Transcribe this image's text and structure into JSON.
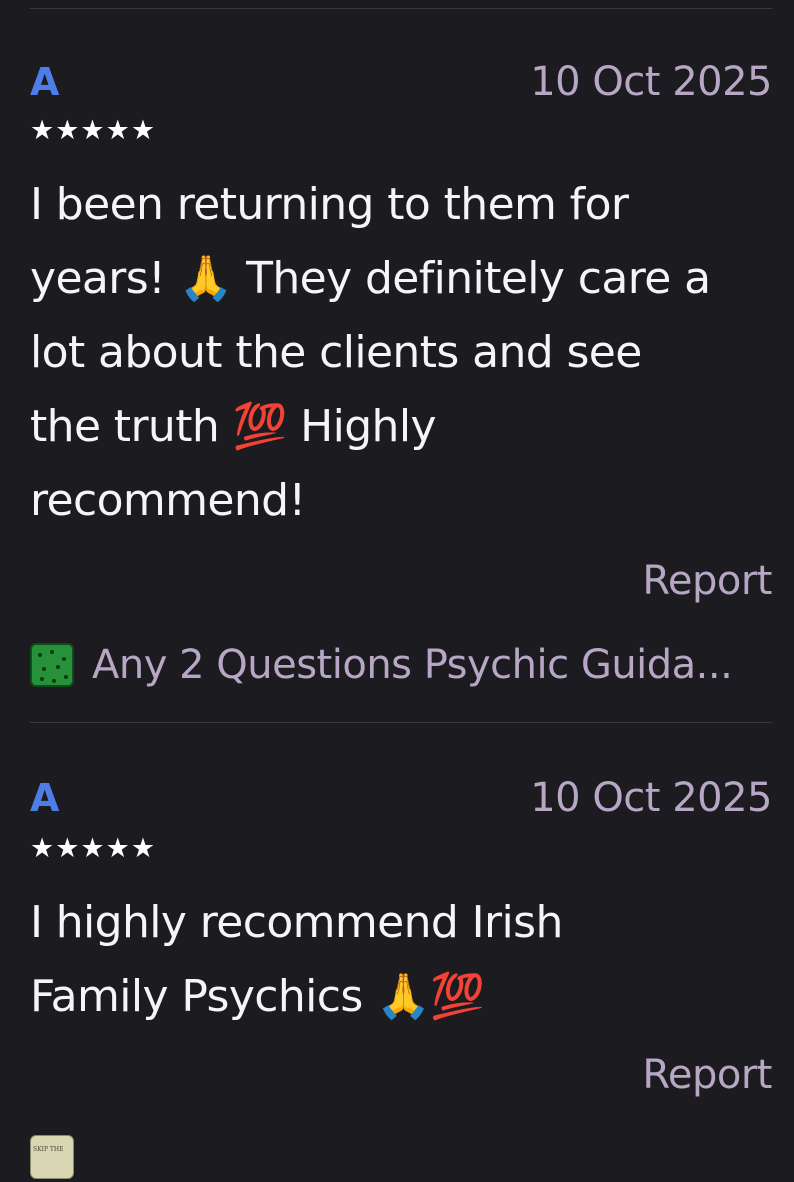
{
  "reviews": [
    {
      "reviewer": "A",
      "date": "10 Oct 2025",
      "rating": 5,
      "stars": "★★★★★",
      "text_lines": [
        "I been returning to them for",
        "years! 🙏 They definitely care a",
        "lot about the clients and see",
        "the truth 💯 Highly",
        "recommend!"
      ],
      "report_label": "Report",
      "product": {
        "title": "Any 2 Questions Psychic Guida...",
        "thumbnail_icon": "green-product-thumbnail"
      }
    },
    {
      "reviewer": "A",
      "date": "10 Oct 2025",
      "rating": 5,
      "stars": "★★★★★",
      "text_lines": [
        "I highly recommend Irish",
        "Family Psychics 🙏💯"
      ],
      "report_label": "Report",
      "product": {
        "title": "",
        "thumbnail_text": "SKIP THE",
        "thumbnail_icon": "pale-product-thumbnail"
      }
    }
  ],
  "colors": {
    "background": "#1c1b20",
    "reviewer_initial": "#4d7ee8",
    "muted_text": "#b7a6c4",
    "body_text": "#f6f4f7",
    "divider": "#39373e"
  }
}
